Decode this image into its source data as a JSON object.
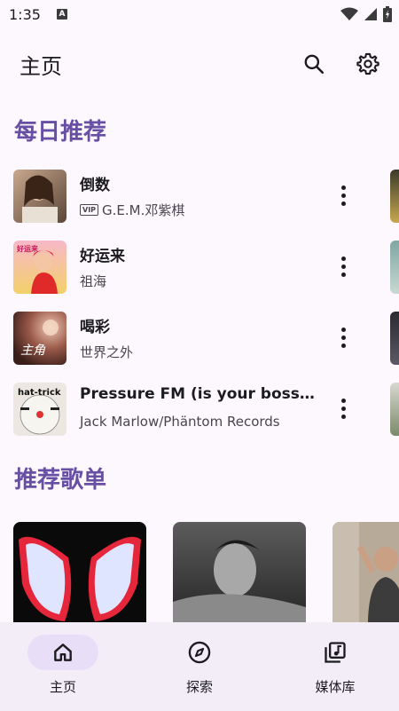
{
  "status": {
    "time": "1:35",
    "notification_icon": "A"
  },
  "header": {
    "title": "主页",
    "search_icon": "search-icon",
    "settings_icon": "gear-icon"
  },
  "daily": {
    "title": "每日推荐",
    "songs": [
      {
        "title": "倒数",
        "vip": "VIP",
        "artist": "G.E.M.邓紫棋"
      },
      {
        "title": "好运来",
        "artist": "祖海",
        "cover_text": "好运来"
      },
      {
        "title": "喝彩",
        "artist": "世界之外",
        "cover_text": "主角"
      },
      {
        "title": "Pressure FM (is your boss be...",
        "artist": "Jack Marlow/Phäntom Records",
        "cover_text": "hat-trick"
      }
    ]
  },
  "playlists": {
    "title": "推荐歌单"
  },
  "nav": {
    "items": [
      {
        "label": "主页",
        "icon": "home-icon",
        "active": true
      },
      {
        "label": "探索",
        "icon": "compass-icon",
        "active": false
      },
      {
        "label": "媒体库",
        "icon": "library-music-icon",
        "active": false
      }
    ]
  },
  "colors": {
    "accent": "#6750a4",
    "background": "#fdf7fe",
    "nav_bg": "#f3edf7",
    "active_pill": "#e8def8"
  }
}
